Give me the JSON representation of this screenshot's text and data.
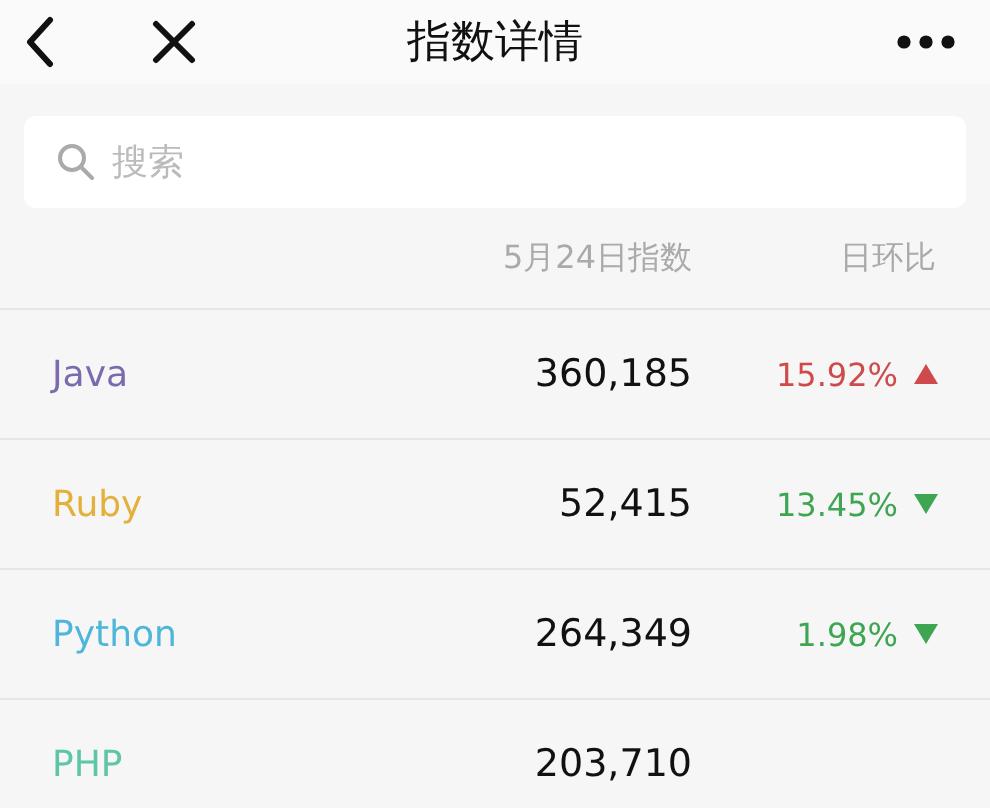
{
  "title": "指数详情",
  "search": {
    "placeholder": "搜索"
  },
  "columns": {
    "index": "5月24日指数",
    "change": "日环比"
  },
  "rows": [
    {
      "name": "Java",
      "color": "#7b6aae",
      "index": "360,185",
      "change": "15.92%",
      "kind": "up"
    },
    {
      "name": "Ruby",
      "color": "#e3b03c",
      "index": "52,415",
      "change": "13.45%",
      "kind": "down"
    },
    {
      "name": "Python",
      "color": "#4db6d9",
      "index": "264,349",
      "change": "1.98%",
      "kind": "down"
    },
    {
      "name": "PHP",
      "color": "#5cc6a6",
      "index": "203,710"
    }
  ]
}
